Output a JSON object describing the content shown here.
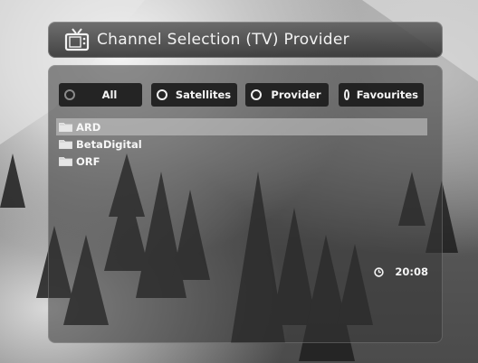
{
  "header": {
    "title": "Channel Selection  (TV) Provider",
    "icon": "tv-icon"
  },
  "tabs": [
    {
      "label": "All",
      "state": "dim"
    },
    {
      "label": "Satellites",
      "state": "normal"
    },
    {
      "label": "Provider",
      "state": "active"
    },
    {
      "label": "Favourites",
      "state": "normal"
    }
  ],
  "providers": [
    {
      "label": "ARD",
      "selected": true,
      "icon": "folder-icon"
    },
    {
      "label": "BetaDigital",
      "selected": false,
      "icon": "folder-icon"
    },
    {
      "label": "ORF",
      "selected": false,
      "icon": "folder-icon"
    }
  ],
  "status": {
    "time": "20:08",
    "icon": "clock-icon"
  }
}
